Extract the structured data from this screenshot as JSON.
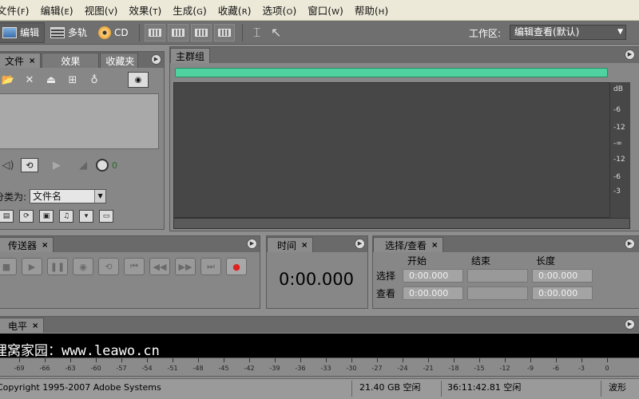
{
  "menu": [
    {
      "label": "文件",
      "key": "F"
    },
    {
      "label": "编辑",
      "key": "E"
    },
    {
      "label": "视图",
      "key": "V"
    },
    {
      "label": "效果",
      "key": "T"
    },
    {
      "label": "生成",
      "key": "G"
    },
    {
      "label": "收藏",
      "key": "R"
    },
    {
      "label": "选项",
      "key": "O"
    },
    {
      "label": "窗口",
      "key": "W"
    },
    {
      "label": "帮助",
      "key": "H"
    }
  ],
  "toolbar": {
    "edit_label": "编辑",
    "multitrack_label": "多轨",
    "cd_label": "CD",
    "workspace_label": "工作区:",
    "workspace_value": "编辑查看(默认)"
  },
  "files_panel": {
    "tabs": [
      "文件",
      "效果",
      "收藏夹"
    ],
    "sort_label": "分类为:",
    "sort_value": "文件名",
    "volume_value": "0"
  },
  "main_group": {
    "tab": "主群组",
    "ruler_labels": [
      "dB",
      "-6",
      "-12",
      "-∞",
      "-12",
      "-6",
      "-3"
    ]
  },
  "transport": {
    "tab": "传送器"
  },
  "time_panel": {
    "tab": "时间",
    "time": "0:00.000"
  },
  "selection_panel": {
    "tab": "选择/查看",
    "col_start": "开始",
    "col_end": "结束",
    "col_length": "长度",
    "row_selection": "选择",
    "row_view": "查看",
    "selection": {
      "start": "0:00.000",
      "end": "",
      "length": "0:00.000"
    },
    "view": {
      "start": "0:00.000",
      "end": "",
      "length": "0:00.000"
    }
  },
  "levels": {
    "tab": "电平",
    "overlay_text": "狸窝家园：www.leawo.cn",
    "ticks": [
      "-69",
      "-66",
      "-63",
      "-60",
      "-57",
      "-54",
      "-51",
      "-48",
      "-45",
      "-42",
      "-39",
      "-36",
      "-33",
      "-30",
      "-27",
      "-24",
      "-21",
      "-18",
      "-15",
      "-12",
      "-9",
      "-6",
      "-3",
      "0"
    ]
  },
  "status": {
    "copyright": "Copyright 1995-2007 Adobe Systems",
    "disk_free": "21.40 GB 空闲",
    "time_free": "36:11:42.81 空闲",
    "view_mode": "波形"
  }
}
